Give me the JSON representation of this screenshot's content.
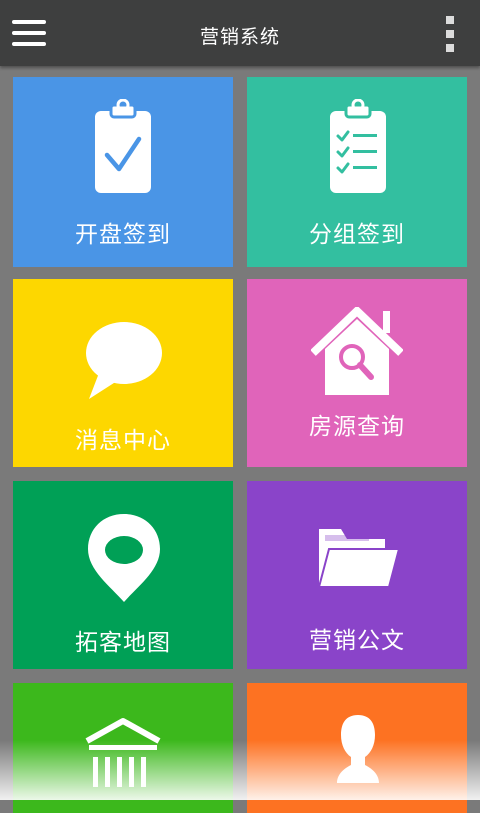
{
  "header": {
    "title": "营销系统",
    "menu_icon": "hamburger-menu-icon",
    "more_icon": "overflow-menu-icon"
  },
  "tiles": [
    {
      "label": "开盘签到",
      "icon": "clipboard-check-icon",
      "color": "#4a95e6"
    },
    {
      "label": "分组签到",
      "icon": "clipboard-checklist-icon",
      "color": "#33bfa0"
    },
    {
      "label": "消息中心",
      "icon": "speech-bubble-icon",
      "color": "#fdd700"
    },
    {
      "label": "房源查询",
      "icon": "house-search-icon",
      "color": "#e064ba"
    },
    {
      "label": "拓客地图",
      "icon": "map-pin-icon",
      "color": "#00a056"
    },
    {
      "label": "营销公文",
      "icon": "folder-icon",
      "color": "#8a44c9"
    },
    {
      "label": "",
      "icon": "bank-building-icon",
      "color": "#3cb81c"
    },
    {
      "label": "",
      "icon": "person-icon",
      "color": "#fd7222"
    }
  ]
}
